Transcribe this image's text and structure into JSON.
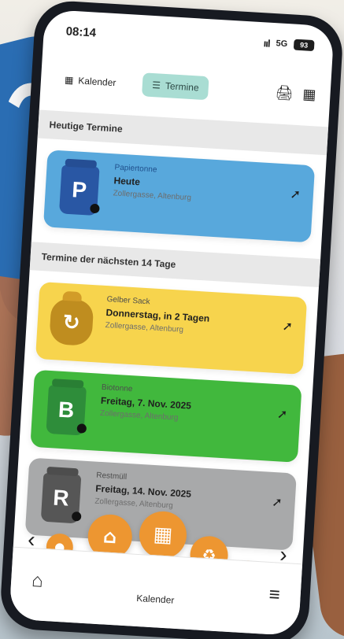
{
  "status": {
    "time": "08:14",
    "signal": "ııl",
    "network": "5G",
    "battery": "93"
  },
  "tabs": [
    {
      "label": "Kalender",
      "icon": "calendar-icon"
    },
    {
      "label": "Termine",
      "icon": "list-icon",
      "active": true
    }
  ],
  "actions": [
    {
      "icon": "printer-icon"
    },
    {
      "icon": "calendar-icon"
    }
  ],
  "sections": {
    "today": "Heutige Termine",
    "upcoming": "Termine der nächsten 14 Tage"
  },
  "cards": [
    {
      "type": "Papiertonne",
      "date": "Heute",
      "place": "Zollergasse, Altenburg",
      "letter": "P",
      "accent": "#58a8dc"
    },
    {
      "type": "Gelber Sack",
      "date": "Donnerstag, in 2 Tagen",
      "place": "Zollergasse, Altenburg",
      "letter": "↻",
      "accent": "#f7d44d"
    },
    {
      "type": "Biotonne",
      "date": "Freitag, 7. Nov. 2025",
      "place": "Zollergasse, Altenburg",
      "letter": "B",
      "accent": "#41b83d"
    },
    {
      "type": "Restmüll",
      "date": "Freitag, 14. Nov. 2025",
      "place": "Zollergasse, Altenburg",
      "letter": "R",
      "accent": "#a8a9aa"
    }
  ],
  "fabs": [
    {
      "label": "●",
      "icon": "small-circle-icon"
    },
    {
      "label": "⌂",
      "icon": "home-icon"
    },
    {
      "label": "▦",
      "icon": "calendar-icon"
    },
    {
      "label": "♻",
      "icon": "recycle-icon"
    },
    {
      "label": "◔",
      "icon": "small-info-icon"
    }
  ],
  "bottom_nav": {
    "home": "⌂",
    "label": "Kalender",
    "menu": "≡"
  },
  "arrows": {
    "left": "‹",
    "right": "›"
  },
  "colors": {
    "accent_orange": "#ed9631",
    "tab_active_bg": "#a9ddd3"
  }
}
